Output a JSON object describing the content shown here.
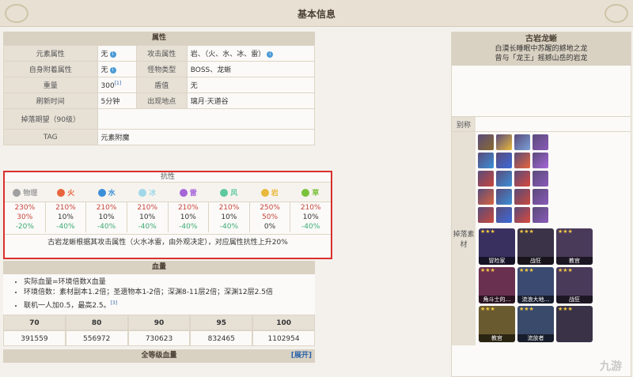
{
  "header": {
    "title": "基本信息"
  },
  "attr": {
    "title": "属性",
    "rows": [
      [
        "元素属性",
        "无",
        "攻击属性",
        "岩、（火、水、冰、雷）"
      ],
      [
        "自身附着属性",
        "无",
        "怪物类型",
        "BOSS、龙蜥"
      ],
      [
        "重量",
        "300",
        "盾值",
        "无"
      ],
      [
        "刷新时间",
        "5分钟",
        "出现地点",
        "璃月·天遒谷"
      ]
    ],
    "drop_label": "掉落期望（90级）",
    "tag_label": "TAG",
    "tag_value": "元素附魔",
    "weight_ref": "[1]"
  },
  "resist": {
    "title": "抗性",
    "cols": [
      {
        "name": "物理",
        "color": "#a0a0a0",
        "v": [
          "230%",
          "30%",
          "-20%"
        ],
        "c": [
          "red",
          "red",
          "grn"
        ]
      },
      {
        "name": "火",
        "color": "#e8643c",
        "v": [
          "210%",
          "10%",
          "-40%"
        ],
        "c": [
          "red",
          "blk",
          "grn"
        ]
      },
      {
        "name": "水",
        "color": "#3b8fd8",
        "v": [
          "210%",
          "10%",
          "-40%"
        ],
        "c": [
          "red",
          "blk",
          "grn"
        ]
      },
      {
        "name": "冰",
        "color": "#9fd8e8",
        "v": [
          "210%",
          "10%",
          "-40%"
        ],
        "c": [
          "red",
          "blk",
          "grn"
        ]
      },
      {
        "name": "雷",
        "color": "#a666d8",
        "v": [
          "210%",
          "10%",
          "-40%"
        ],
        "c": [
          "red",
          "blk",
          "grn"
        ]
      },
      {
        "name": "风",
        "color": "#5cc8a0",
        "v": [
          "210%",
          "10%",
          "-40%"
        ],
        "c": [
          "red",
          "blk",
          "grn"
        ]
      },
      {
        "name": "岩",
        "color": "#e8b83c",
        "v": [
          "250%",
          "50%",
          "0%"
        ],
        "c": [
          "red",
          "red",
          "blk"
        ]
      },
      {
        "name": "草",
        "color": "#7ac23c",
        "v": [
          "210%",
          "10%",
          "-40%"
        ],
        "c": [
          "red",
          "blk",
          "grn"
        ]
      }
    ],
    "note": "古岩龙蜥根据其攻击属性（火水冰雷，由外观决定），对应属性抗性上升20%"
  },
  "hp": {
    "title": "血量",
    "items": [
      "实际血量=环境倍数X血量",
      "环境倍数：素材副本1.2倍；圣遗物本1-2倍；深渊8-11层2倍；深渊12层2.5倍",
      "联机一人加0.5，最高2.5。"
    ],
    "ref": "[3]",
    "levels": [
      "70",
      "80",
      "90",
      "95",
      "100"
    ],
    "values": [
      "391559",
      "556972",
      "730623",
      "832465",
      "1102954"
    ],
    "all_title": "全等级血量",
    "expand": "展开"
  },
  "monster": {
    "name": "古岩龙蜥",
    "desc1": "白漠长睡眠中苏醒的撼地之龙",
    "desc2": "曾与「龙王」摇撼山岳的岩龙",
    "alias": "别称",
    "drops": "掉落素材",
    "cards": [
      "冒险家",
      "战狂",
      "教官",
      "角斗士的…",
      "流浪大地…",
      "战狂",
      "教官",
      "流放者",
      ""
    ]
  },
  "watermark": "九游"
}
